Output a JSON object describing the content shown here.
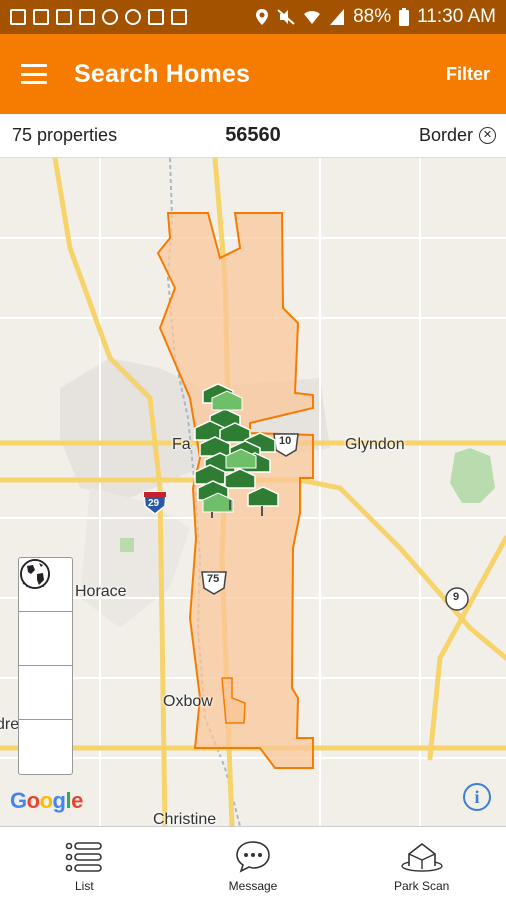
{
  "status_bar": {
    "battery": "88%",
    "time": "11:30 AM",
    "icons": [
      "image-icon",
      "gallery-icon",
      "cast-icon",
      "phone-icon",
      "dropbox-icon",
      "weather-icon",
      "home-icon",
      "document-icon",
      "location-icon",
      "mute-icon",
      "wifi-icon",
      "signal-icon",
      "battery-icon"
    ]
  },
  "app_bar": {
    "title": "Search Homes",
    "filter_label": "Filter",
    "background": "#f57c00"
  },
  "info_bar": {
    "property_count": "75 properties",
    "zip": "56560",
    "border_label": "Border"
  },
  "map": {
    "labels": {
      "city_fargo": "Fa",
      "glyndon": "Glyndon",
      "horace": "Horace",
      "oxbow": "Oxbow",
      "christine": "Christine",
      "left_edge": "dre",
      "i29": "29",
      "us10": "10",
      "us75": "75",
      "hwy9": "9"
    },
    "attribution": "Google",
    "boundary_color": "#f57c00"
  },
  "map_tools": [
    "navigate-icon",
    "draw-icon",
    "road-icon",
    "globe-icon"
  ],
  "bottom_nav": {
    "list_label": "List",
    "message_label": "Message",
    "park_scan_label": "Park Scan"
  }
}
